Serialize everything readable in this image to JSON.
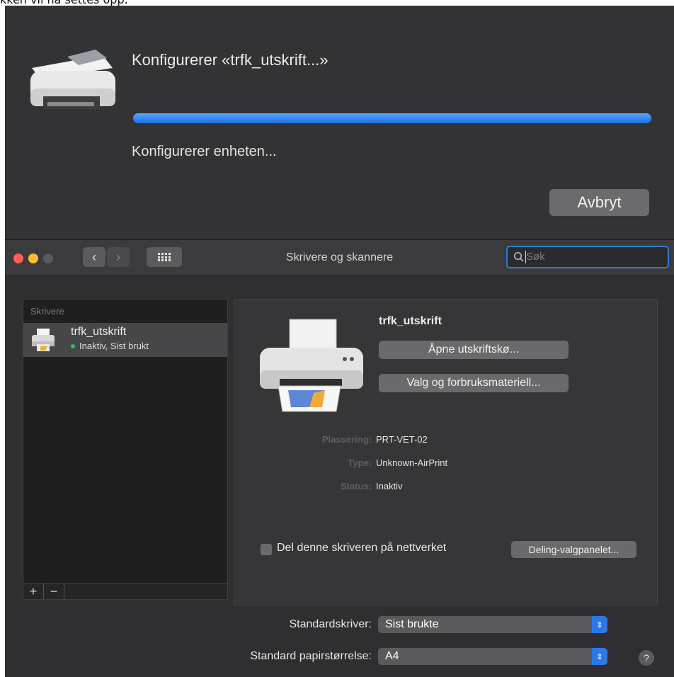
{
  "caption": "kken vil nå settes opp.",
  "sheet": {
    "title": "Konfigurerer «trfk_utskrift...»",
    "status": "Konfigurerer enheten...",
    "cancel_label": "Avbryt",
    "progress": 1.0
  },
  "window": {
    "title": "Skrivere og skannere",
    "search_placeholder": "Søk",
    "colors": {
      "close": "#fe5f57",
      "minimize": "#febc2e",
      "zoom_disabled": "#5a5a5c",
      "accent": "#2a79e6"
    }
  },
  "printer_list": {
    "header": "Skrivere",
    "items": [
      {
        "name": "trfk_utskrift",
        "status": "Inaktiv, Sist brukt"
      }
    ],
    "add_label": "+",
    "remove_label": "−"
  },
  "details": {
    "name": "trfk_utskrift",
    "open_queue_label": "Åpne utskriftskø...",
    "options_label": "Valg og forbruksmateriell...",
    "location_label": "Plassering:",
    "location_value": "PRT-VET-02",
    "type_label": "Type:",
    "type_value": "Unknown-AirPrint",
    "status_label": "Status:",
    "status_value": "Inaktiv",
    "share_label": "Del denne skriveren på nettverket",
    "share_checked": false,
    "sharing_prefs_label": "Deling-valgpanelet..."
  },
  "defaults": {
    "printer_label": "Standardskriver:",
    "printer_value": "Sist brukte",
    "paper_label": "Standard papirstørrelse:",
    "paper_value": "A4",
    "help_label": "?"
  }
}
